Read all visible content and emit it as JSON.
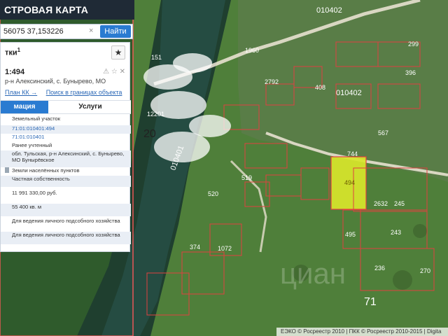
{
  "header": {
    "title": "СТРОВАЯ КАРТА"
  },
  "search": {
    "query": "56075 37,153226",
    "clear_glyph": "×",
    "button": "Найти"
  },
  "panel": {
    "header": "тки",
    "header_count": "1",
    "favorite_icon": "star",
    "cad_number": "1:494",
    "address": "р-н Алексинский, с. Бунырево, МО",
    "links": [
      "План КК →",
      "Поиск в границах объекта →"
    ],
    "tabs": [
      "мация",
      "Услуги"
    ],
    "rows": [
      {
        "text": "Земельный участок",
        "style": "plain"
      },
      {
        "text": "71:01:010401:494",
        "style": "link"
      },
      {
        "text": "71:01:010401",
        "style": "link"
      },
      {
        "text": "Ранее учтенный",
        "style": "plain"
      },
      {
        "text": "обл. Тульская, р-н Алексинский, с. Бунырево, МО Бунырёвское",
        "style": "alt"
      },
      {
        "text": "Земли населённых пунктов",
        "style": "plain"
      },
      {
        "text": "Частная собственность",
        "style": "alt"
      },
      {
        "text": "11 991 330,00 руб.",
        "style": "plain"
      },
      {
        "text": "55 400 кв. м",
        "style": "alt"
      },
      {
        "text": "Для ведения личного подсобного хозяйства",
        "style": "plain"
      },
      {
        "text": "Для ведения личного подсобного хозяйства",
        "style": "alt"
      }
    ]
  },
  "map_labels": {
    "q1": "010402",
    "q2": "010402",
    "q3": "010401",
    "region": "20",
    "parcel": "494",
    "plot_labels": [
      "151",
      "520",
      "519",
      "1072",
      "374",
      "408",
      "567",
      "744",
      "2632",
      "245",
      "243",
      "236",
      "495",
      "270",
      "299",
      "396",
      "2792",
      "1960",
      "12201"
    ],
    "bottom_number": "71"
  },
  "footer": {
    "attribution": "ЕЭКО © Росреестр 2010 | ПКК © Росреестр 2010-2015 | Digita"
  },
  "watermark": "циан",
  "colors": {
    "parcel_line": "#e04040",
    "highlight": "#d8e62b",
    "button": "#2a7bd1",
    "panel_bg": "#ffffff"
  }
}
